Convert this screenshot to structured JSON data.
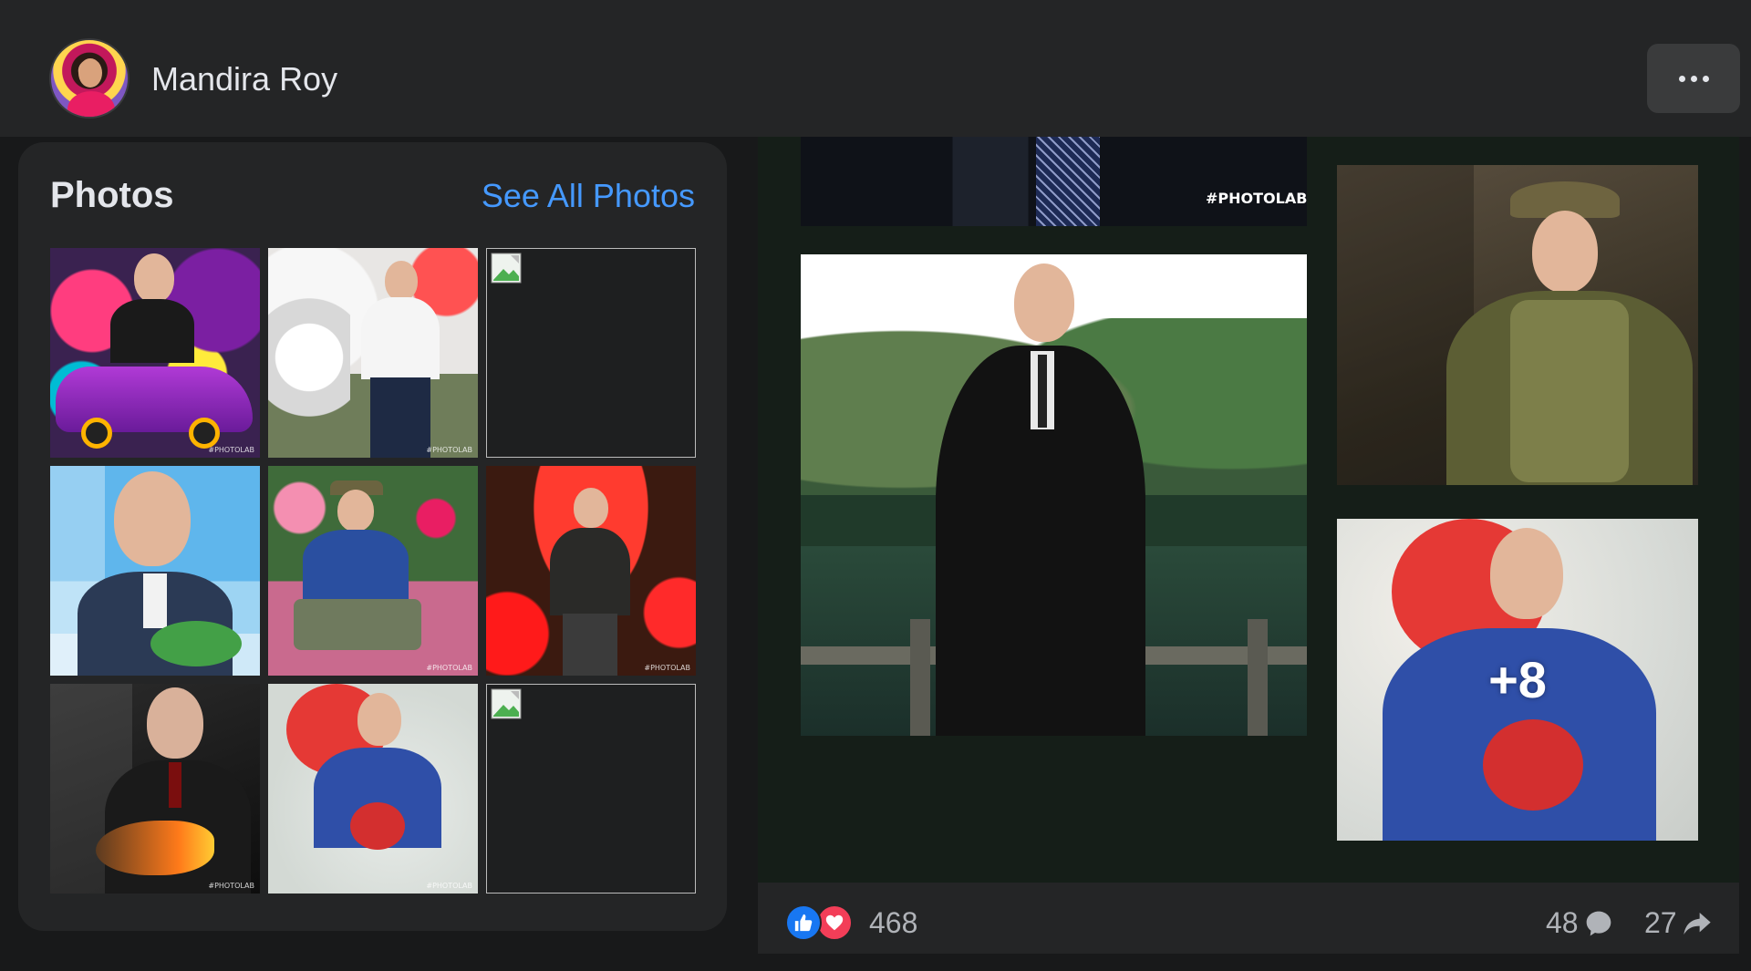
{
  "header": {
    "user_name": "Mandira Roy",
    "more_label": "More options"
  },
  "photos": {
    "title": "Photos",
    "see_all": "See All Photos",
    "tiles": [
      {
        "kind": "photo",
        "watermark": "#PHOTOLAB"
      },
      {
        "kind": "photo",
        "watermark": "#PHOTOLAB"
      },
      {
        "kind": "broken"
      },
      {
        "kind": "photo"
      },
      {
        "kind": "photo",
        "watermark": "#PHOTOLAB"
      },
      {
        "kind": "photo",
        "watermark": "#PHOTOLAB"
      },
      {
        "kind": "photo",
        "watermark": "#PHOTOLAB"
      },
      {
        "kind": "photo",
        "watermark": "#PHOTOLAB"
      },
      {
        "kind": "broken"
      }
    ]
  },
  "post": {
    "top_watermark": "#PHOTOLAB",
    "more_count": "+8"
  },
  "footer": {
    "reactions_count": "468",
    "comments_count": "48",
    "shares_count": "27"
  },
  "colors": {
    "background": "#18191a",
    "card": "#242526",
    "link": "#4599ff",
    "like": "#1877f2",
    "love": "#f33e58"
  },
  "icons": [
    "more-icon",
    "like-reaction-icon",
    "love-reaction-icon",
    "comment-icon",
    "share-icon",
    "broken-image-icon"
  ]
}
